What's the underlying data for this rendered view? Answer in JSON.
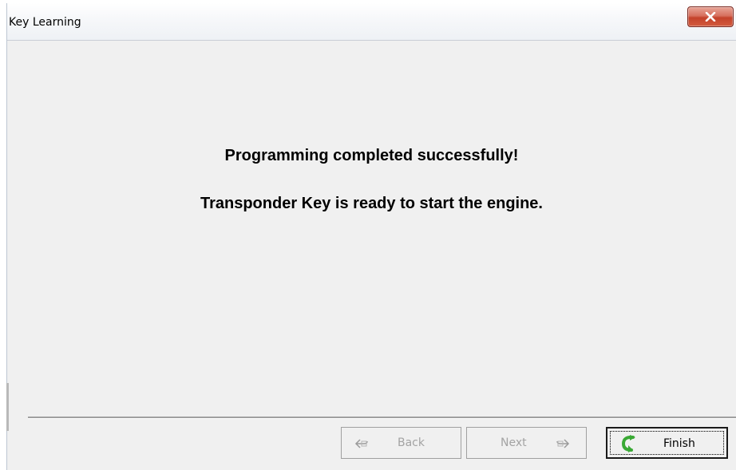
{
  "window": {
    "title": "Key Learning",
    "close_glyph": "X"
  },
  "message": {
    "line1": "Programming completed successfully!",
    "line2": "Transponder Key is ready to start the engine."
  },
  "buttons": {
    "back": {
      "label": "Back",
      "enabled": false,
      "icon": "back-arrow-icon"
    },
    "next": {
      "label": "Next",
      "enabled": false,
      "icon": "next-arrow-icon"
    },
    "finish": {
      "label": "Finish",
      "enabled": true,
      "focused": true,
      "icon": "green-return-arrow-icon"
    }
  },
  "colors": {
    "close_button": "#c4422b",
    "finish_icon": "#3aa935",
    "disabled_text": "#a3a3a3"
  }
}
